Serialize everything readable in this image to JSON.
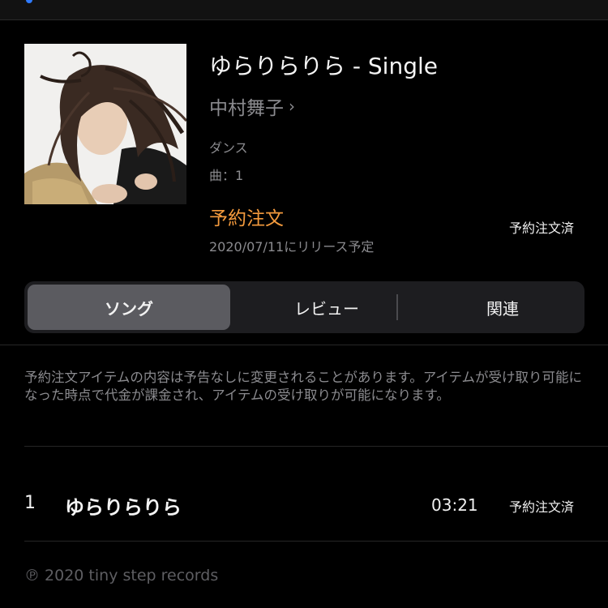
{
  "album": {
    "title": "ゆらりらりら - Single",
    "artist": "中村舞子",
    "artist_chevron": "›",
    "genre": "ダンス",
    "song_count": "曲：1",
    "preorder_label": "予約注文",
    "preorder_status": "予約注文済",
    "release_text": "2020/07/11にリリース予定"
  },
  "tabs": [
    {
      "label": "ソング",
      "selected": true
    },
    {
      "label": "レビュー",
      "selected": false
    },
    {
      "label": "関連",
      "selected": false
    }
  ],
  "notice": "予約注文アイテムの内容は予告なしに変更されることがあります。アイテムが受け取り可能になった時点で代金が課金され、アイテムの受け取りが可能になります。",
  "tracks": [
    {
      "number": "1",
      "title": "ゆらりらりら",
      "duration": "03:21",
      "status": "予約注文済"
    }
  ],
  "footer": {
    "copyright": "℗ 2020 tiny step records"
  },
  "colors": {
    "background": "#000000",
    "accent_orange": "#f39a3d",
    "secondary_text": "#8b8b8f",
    "segment_bg": "#1d1d20",
    "segment_selected": "#5b5b60"
  }
}
